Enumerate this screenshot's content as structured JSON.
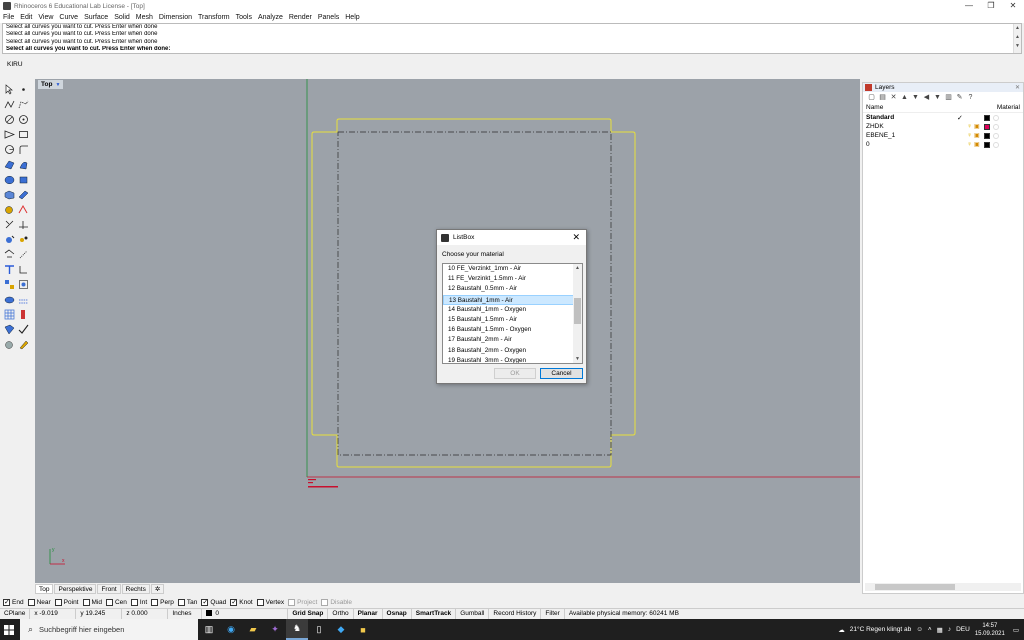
{
  "window": {
    "title": "Rhinoceros 6 Educational Lab License - [Top]",
    "controls": [
      "—",
      "❐",
      "✕"
    ]
  },
  "menu": [
    "File",
    "Edit",
    "View",
    "Curve",
    "Surface",
    "Solid",
    "Mesh",
    "Dimension",
    "Transform",
    "Tools",
    "Analyze",
    "Render",
    "Panels",
    "Help"
  ],
  "command_history": [
    "Select all curves you want to cut. Press Enter when done",
    "Select all curves you want to cut. Press Enter when done",
    "Select all curves you want to cut. Press Enter when done",
    "Select all curves you want to cut. Press Enter when done"
  ],
  "command_prompt": "Select all curves you want to cut. Press Enter when done:",
  "command_input": "KIRU",
  "viewport": {
    "label": "Top",
    "label_arrow": "▼"
  },
  "viewport_tabs": [
    "Top",
    "Perspektive",
    "Front",
    "Rechts",
    "✲"
  ],
  "osnaps": [
    {
      "label": "End",
      "on": true
    },
    {
      "label": "Near",
      "on": false
    },
    {
      "label": "Point",
      "on": false
    },
    {
      "label": "Mid",
      "on": false
    },
    {
      "label": "Cen",
      "on": false
    },
    {
      "label": "Int",
      "on": false
    },
    {
      "label": "Perp",
      "on": false
    },
    {
      "label": "Tan",
      "on": false
    },
    {
      "label": "Quad",
      "on": true
    },
    {
      "label": "Knot",
      "on": true
    },
    {
      "label": "Vertex",
      "on": false
    },
    {
      "label": "Project",
      "on": false,
      "disabled": true
    },
    {
      "label": "Disable",
      "on": false,
      "disabled": true
    }
  ],
  "status": {
    "cplane": "CPlane",
    "x": "x -9.019",
    "y": "y 19.245",
    "z": "z 0.000",
    "units": "Inches",
    "layer": "0",
    "grid_snap": "Grid Snap",
    "ortho": "Ortho",
    "planar": "Planar",
    "osnap": "Osnap",
    "smarttrack": "SmartTrack",
    "gumball": "Gumball",
    "record_history": "Record History",
    "filter": "Filter",
    "memory": "Available physical memory: 60241 MB"
  },
  "layers_panel": {
    "title": "Layers",
    "col_name": "Name",
    "col_material": "Material",
    "rows": [
      {
        "name": "Standard",
        "bold": true,
        "current": true,
        "color": "#000000"
      },
      {
        "name": "ZHDK",
        "bold": false,
        "current": false,
        "color": "#e0005a"
      },
      {
        "name": "EBENE_1",
        "bold": false,
        "current": false,
        "color": "#000000"
      },
      {
        "name": "0",
        "bold": false,
        "current": false,
        "color": "#000000"
      }
    ]
  },
  "dialog": {
    "title": "ListBox",
    "prompt": "Choose your material",
    "items": [
      "10 FE_Verzinkt_1mm - Air",
      "11 FE_Verzinkt_1.5mm - Air",
      "12 Baustahl_0.5mm - Air",
      "13 Baustahl_1mm - Air",
      "14 Baustahl_1mm - Oxygen",
      "15 Baustahl_1.5mm - Air",
      "16 Baustahl_1.5mm - Oxygen",
      "17 Baustahl_2mm - Air",
      "18 Baustahl_2mm - Oxygen",
      "19 Baustahl_3mm - Oxygen"
    ],
    "selected_index": 3,
    "ok_label": "OK",
    "cancel_label": "Cancel"
  },
  "taskbar": {
    "search_placeholder": "Suchbegriff hier eingeben",
    "weather": "21°C  Regen klingt ab",
    "lang": "DEU",
    "time": "14:57",
    "date": "15.09.2021"
  },
  "colors": {
    "curve_yellow": "#e8e03a",
    "axis_red": "#c8102e",
    "axis_green": "#1f8f3a",
    "viewport_bg": "#9ca2a9"
  }
}
